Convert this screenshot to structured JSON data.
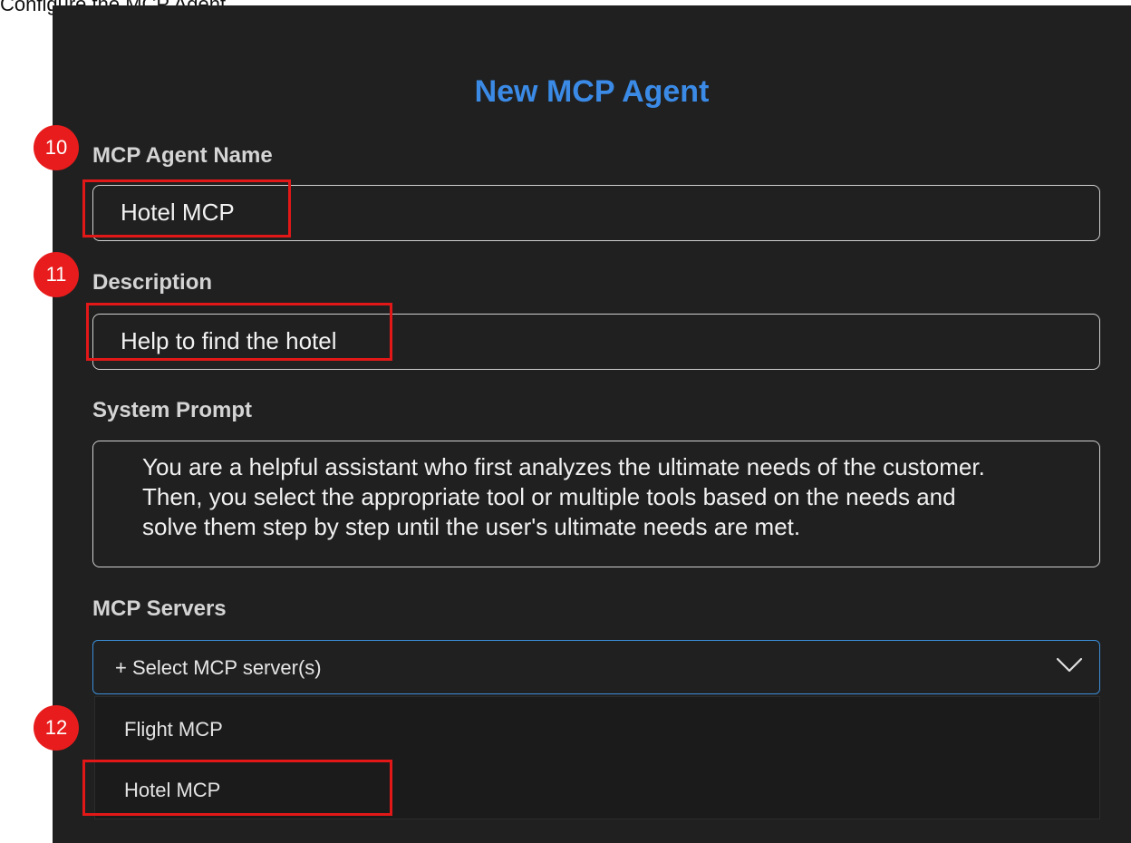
{
  "page": {
    "caption": "Configure the MCP Agent"
  },
  "dialog": {
    "title": "New MCP Agent"
  },
  "fields": {
    "name": {
      "label": "MCP Agent Name",
      "value": "Hotel MCP"
    },
    "description": {
      "label": "Description",
      "value": "Help to find the hotel"
    },
    "system_prompt": {
      "label": "System Prompt",
      "lines": [
        "You are a helpful assistant who first analyzes the ultimate needs of the customer.",
        "Then, you select the appropriate tool or multiple tools based on the needs and",
        "solve them step by step until the user's ultimate needs are met."
      ]
    },
    "mcp_servers": {
      "label": "MCP Servers",
      "placeholder": "+ Select MCP server(s)",
      "options": [
        "Flight MCP",
        "Hotel MCP"
      ]
    }
  },
  "callouts": [
    "10",
    "11",
    "12"
  ],
  "colors": {
    "accent": "#3a8ae6",
    "highlight": "#e21818",
    "panel": "#202020"
  },
  "icons": {
    "select_chevron": "chevron-down-icon"
  }
}
